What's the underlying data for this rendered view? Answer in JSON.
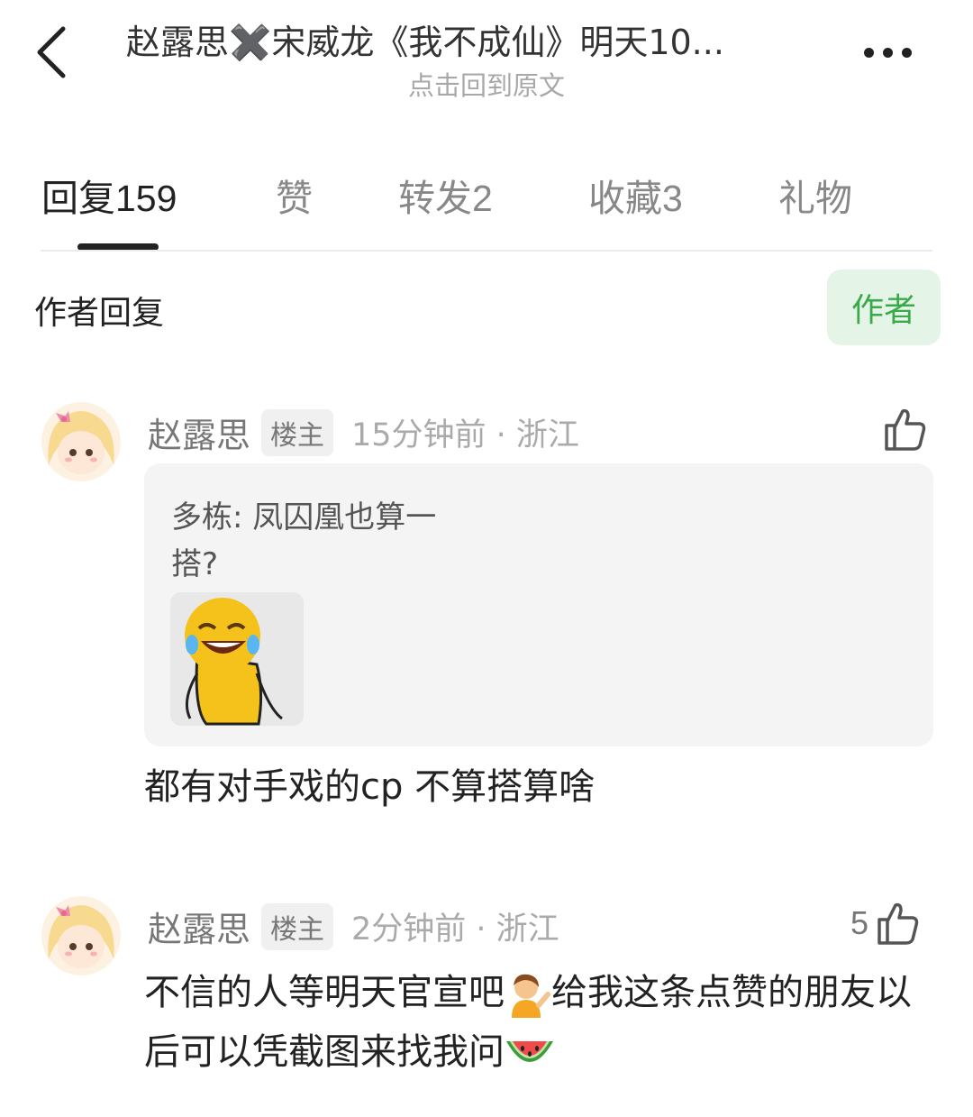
{
  "header": {
    "title": "赵露思✖️宋威龙《我不成仙》明天10...",
    "subtitle": "点击回到原文"
  },
  "tabs": [
    {
      "label": "回复",
      "count": "159"
    },
    {
      "label": "赞",
      "count": ""
    },
    {
      "label": "转发",
      "count": "2"
    },
    {
      "label": "收藏",
      "count": "3"
    },
    {
      "label": "礼物",
      "count": ""
    }
  ],
  "filter": {
    "label": "作者回复",
    "author_button": "作者"
  },
  "comments": [
    {
      "name": "赵露思",
      "badge": "楼主",
      "meta": "15分钟前 · 浙江",
      "likes": "",
      "quote": {
        "author": "多栋",
        "separator": ": ",
        "text": "凤囚凰也算一搭?"
      },
      "text": "都有对手戏的cp 不算搭算啥"
    },
    {
      "name": "赵露思",
      "badge": "楼主",
      "meta": "2分钟前 · 浙江",
      "likes": "5",
      "text_part1": "不信的人等明天官宣吧",
      "text_part2": "给我这条点赞的朋友以后可以凭截图来找我问"
    }
  ],
  "colors": {
    "accent_green": "#39a94a",
    "author_bg": "#e4f4e6",
    "quote_bg": "#f4f4f4"
  }
}
